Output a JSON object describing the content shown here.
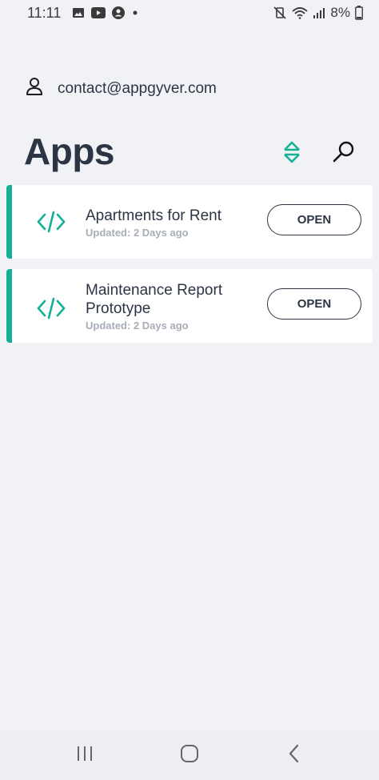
{
  "status_bar": {
    "time": "11:11",
    "battery": "8%",
    "icons_left": [
      "image-icon",
      "youtube-icon",
      "account-circle-icon",
      "dot-icon"
    ],
    "icons_right": [
      "vibrate-off-icon",
      "wifi-icon",
      "signal-icon",
      "battery-icon"
    ]
  },
  "account": {
    "email": "contact@appgyver.com",
    "icon": "user-icon"
  },
  "header": {
    "title": "Apps",
    "sort_icon": "sort-icon",
    "search_icon": "search-icon"
  },
  "apps": [
    {
      "title_line1": "Apartments for Rent",
      "title_line2": "",
      "updated": "Updated: 2 Days ago",
      "button": "OPEN",
      "icon": "code-icon"
    },
    {
      "title_line1": "Maintenance Report",
      "title_line2": "Prototype",
      "updated": "Updated: 2 Days ago",
      "button": "OPEN",
      "icon": "code-icon"
    }
  ],
  "nav_bar": {
    "items": [
      "recents-icon",
      "home-icon",
      "back-icon"
    ]
  },
  "colors": {
    "accent": "#15b095",
    "text": "#2b3544",
    "muted": "#a7adb7",
    "background": "#f1f2f6"
  }
}
